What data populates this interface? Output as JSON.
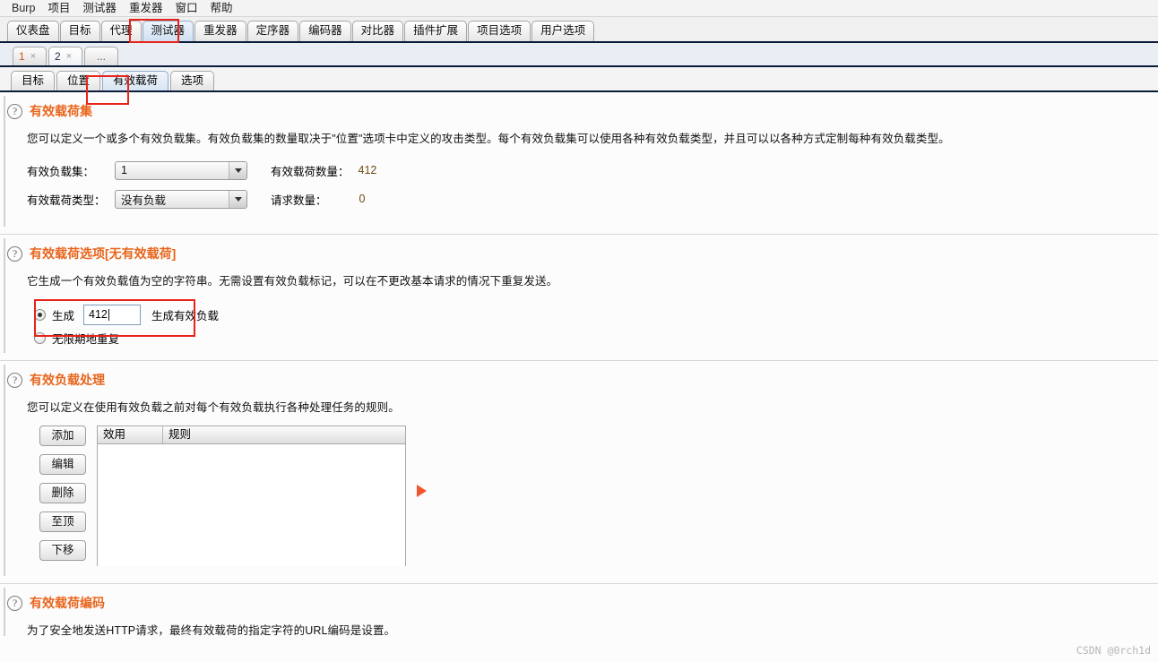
{
  "menubar": {
    "items": [
      {
        "label": "Burp"
      },
      {
        "label": "项目"
      },
      {
        "label": "测试器"
      },
      {
        "label": "重发器"
      },
      {
        "label": "窗口"
      },
      {
        "label": "帮助"
      }
    ]
  },
  "main_tabs": {
    "selected": "测试器",
    "items": [
      {
        "label": "仪表盘"
      },
      {
        "label": "目标"
      },
      {
        "label": "代理"
      },
      {
        "label": "测试器"
      },
      {
        "label": "重发器"
      },
      {
        "label": "定序器"
      },
      {
        "label": "编码器"
      },
      {
        "label": "对比器"
      },
      {
        "label": "插件扩展"
      },
      {
        "label": "项目选项"
      },
      {
        "label": "用户选项"
      }
    ]
  },
  "attack_tabs": {
    "selected": "2",
    "items": [
      {
        "label": "1",
        "close": "×"
      },
      {
        "label": "2",
        "close": "×"
      }
    ],
    "more_label": "..."
  },
  "sub_tabs": {
    "selected": "有效载荷",
    "items": [
      {
        "label": "目标"
      },
      {
        "label": "位置"
      },
      {
        "label": "有效载荷"
      },
      {
        "label": "选项"
      }
    ]
  },
  "sections": {
    "payload_sets": {
      "help_icon": "question-mark-icon",
      "title": "有效载荷集",
      "description": "您可以定义一个或多个有效负载集。有效负载集的数量取决于\"位置\"选项卡中定义的攻击类型。每个有效负载集可以使用各种有效负载类型，并且可以以各种方式定制每种有效负载类型。",
      "set_label": "有效负载集：",
      "set_value": "1",
      "count_label": "有效载荷数量：",
      "count_value": "412",
      "type_label": "有效载荷类型：",
      "type_value": "没有负载",
      "requests_label": "请求数量：",
      "requests_value": "0"
    },
    "payload_options": {
      "help_icon": "question-mark-icon",
      "title": "有效载荷选项[无有效载荷]",
      "description": "它生成一个有效负载值为空的字符串。无需设置有效负载标记，可以在不更改基本请求的情况下重复发送。",
      "radio_generate_label": "生成",
      "generate_value": "412",
      "generate_suffix": "生成有效负载",
      "radio_repeat_label": "无限期地重复",
      "selected_radio": "生成"
    },
    "payload_processing": {
      "help_icon": "question-mark-icon",
      "title": "有效负载处理",
      "description": "您可以定义在使用有效负载之前对每个有效负载执行各种处理任务的规则。",
      "buttons": [
        {
          "label": "添加"
        },
        {
          "label": "编辑"
        },
        {
          "label": "删除"
        },
        {
          "label": "至顶"
        },
        {
          "label": "下移"
        }
      ],
      "table": {
        "columns": [
          "效用",
          "规则"
        ],
        "rows": []
      },
      "expand_icon": "play-triangle-icon"
    },
    "payload_encoding": {
      "help_icon": "question-mark-icon",
      "title": "有效载荷编码",
      "description": "为了安全地发送HTTP请求，最终有效载荷的指定字符的URL编码是设置。"
    }
  },
  "highlights": {
    "color": "#e8231a",
    "targets": [
      "测试器",
      "有效载荷",
      "生成"
    ]
  },
  "watermark": "CSDN @0rch1d"
}
